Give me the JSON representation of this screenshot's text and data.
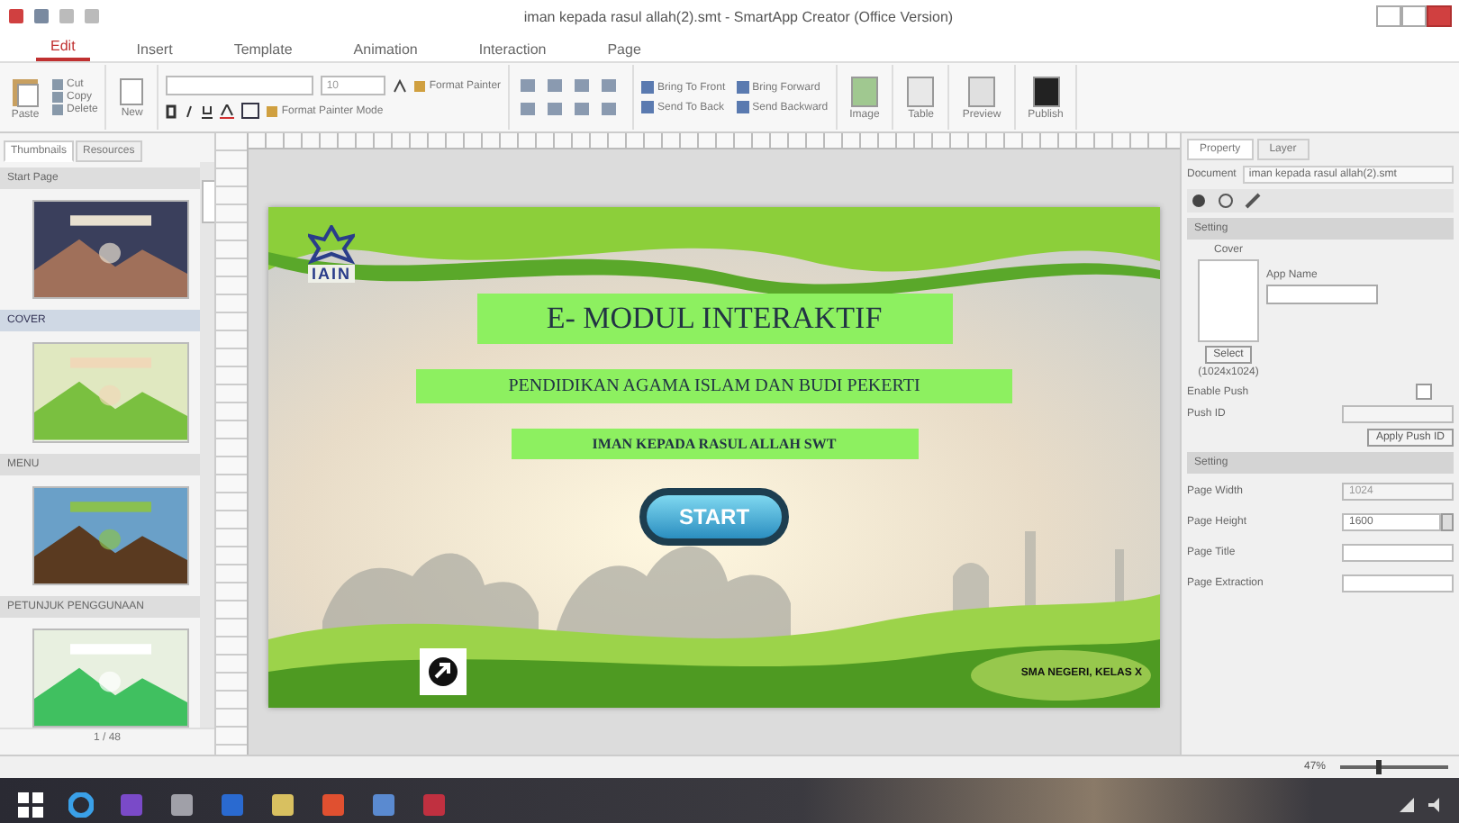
{
  "window": {
    "title": "iman kepada rasul allah(2).smt - SmartApp Creator (Office Version)"
  },
  "ribbon": {
    "tabs": [
      {
        "label": "Edit",
        "selected": true
      },
      {
        "label": "Insert",
        "selected": false
      },
      {
        "label": "Template",
        "selected": false
      },
      {
        "label": "Animation",
        "selected": false
      },
      {
        "label": "Interaction",
        "selected": false
      },
      {
        "label": "Page",
        "selected": false
      }
    ],
    "paste": "Paste",
    "clipboard": [
      "Cut",
      "Copy",
      "Delete"
    ],
    "new": "New",
    "font_size": "10",
    "format": [
      "Format Painter",
      "Format Painter Mode"
    ],
    "arrange": [
      "Bring To Front",
      "Bring Forward",
      "Send To Back",
      "Send Backward"
    ],
    "large_buttons": [
      "Image",
      "Table",
      "Preview",
      "Publish"
    ]
  },
  "pages_panel": {
    "tabs": [
      {
        "label": "Thumbnails",
        "selected": true
      },
      {
        "label": "Resources",
        "selected": false
      }
    ],
    "groups": [
      {
        "title": "Start Page",
        "selected": false
      },
      {
        "title": "COVER",
        "selected": true
      },
      {
        "title": "MENU",
        "selected": false
      },
      {
        "title": "PETUNJUK PENGGUNAAN",
        "selected": false
      }
    ],
    "page_counter": "1 / 48"
  },
  "slide": {
    "logo_text": "IAIN",
    "title": "E- MODUL INTERAKTIF",
    "subtitle": "PENDIDIKAN AGAMA ISLAM DAN BUDI PEKERTI",
    "topic": "IMAN KEPADA RASUL ALLAH SWT",
    "start_button": "START",
    "footer": "SMA NEGERI, KELAS X"
  },
  "property_panel": {
    "tabs": [
      {
        "label": "Property",
        "selected": true
      },
      {
        "label": "Layer",
        "selected": false
      }
    ],
    "document_label": "Document",
    "document_value": "iman kepada rasul allah(2).smt",
    "app_setting": {
      "header": "Setting",
      "cover_label": "Cover",
      "app_name_label": "App Name",
      "select_button": "Select",
      "cover_size": "(1024x1024)",
      "enable_push_label": "Enable Push",
      "enable_push": false,
      "push_id_label": "Push ID",
      "apply_button": "Apply Push ID"
    },
    "page_setting": {
      "header": "Setting",
      "fields": [
        {
          "label": "Page Width",
          "value": "1024",
          "kind": "readonly"
        },
        {
          "label": "Page Height",
          "value": "1600",
          "kind": "spinner"
        },
        {
          "label": "Page Title",
          "kind": "text"
        },
        {
          "label": "Page Extraction",
          "kind": "text"
        }
      ]
    }
  },
  "status_bar": {
    "zoom": {
      "reading": "47%",
      "level": 0.33
    }
  }
}
